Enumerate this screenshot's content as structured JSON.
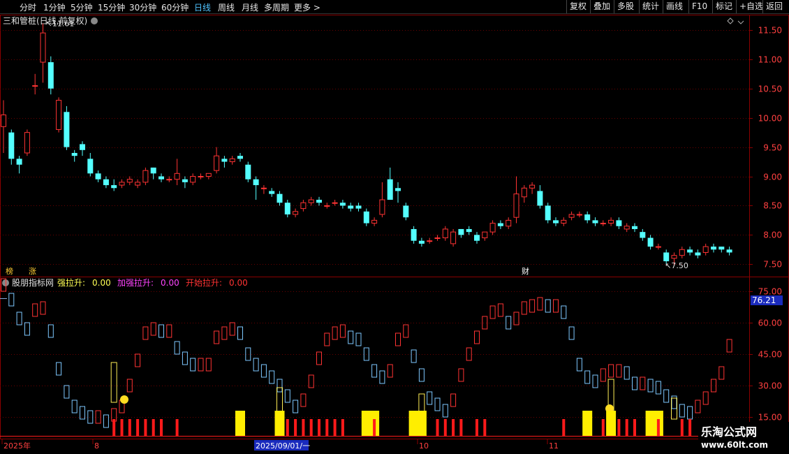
{
  "toolbar": {
    "periods": [
      "分时",
      "1分钟",
      "5分钟",
      "15分钟",
      "30分钟",
      "60分钟",
      "日线",
      "周线",
      "月线",
      "多周期",
      "更多 >"
    ],
    "active": "日线",
    "right": [
      "复权",
      "叠加",
      "多股",
      "统计",
      "画线",
      "F10",
      "标记",
      "+自选",
      "返回"
    ]
  },
  "main": {
    "title": "三和管桩(日线,前复权)",
    "y_ticks": [
      "11.50",
      "11.00",
      "10.50",
      "10.00",
      "9.50",
      "9.00",
      "8.50",
      "8.00",
      "7.50"
    ],
    "high_label": "11.61",
    "low_label": "7.50",
    "markers": [
      "榜",
      "涨",
      "财"
    ]
  },
  "indicator": {
    "name": "股朋指标网",
    "items": [
      {
        "label": "强拉升:",
        "value": "0.00",
        "color": "#ffff55"
      },
      {
        "label": "加强拉升:",
        "value": "0.00",
        "color": "#ff44ff"
      },
      {
        "label": "开始拉升:",
        "value": "0.00",
        "color": "#ff3333"
      }
    ],
    "current": "76.21",
    "y_ticks": [
      "75.00",
      "60.00",
      "45.00",
      "30.00",
      "15.00"
    ]
  },
  "dates": [
    "2025年",
    "8",
    "2025/09/01/一",
    "10",
    "11"
  ],
  "watermark": {
    "name": "乐淘公式网",
    "url": "www.60lt.com"
  },
  "colors": {
    "up": "#ff3333",
    "down": "#54ffff",
    "grid": "#8b0000",
    "hlines": "#6a0000"
  },
  "chart_data": {
    "type": "candlestick",
    "ylim": [
      7.3,
      11.75
    ],
    "candles": [
      [
        9.85,
        10.05,
        9.4,
        10.3
      ],
      [
        9.75,
        9.3,
        9.2,
        9.8
      ],
      [
        9.3,
        9.2,
        9.05,
        9.35
      ],
      [
        9.4,
        9.75,
        9.35,
        9.8
      ],
      [
        10.55,
        10.55,
        10.4,
        10.75
      ],
      [
        10.95,
        11.45,
        10.6,
        11.61
      ],
      [
        10.95,
        10.5,
        10.4,
        11.05
      ],
      [
        9.8,
        10.3,
        9.75,
        10.35
      ],
      [
        10.1,
        9.5,
        9.45,
        10.2
      ],
      [
        9.4,
        9.35,
        9.25,
        9.45
      ],
      [
        9.55,
        9.45,
        9.35,
        9.6
      ],
      [
        9.3,
        9.05,
        9.0,
        9.4
      ],
      [
        9.05,
        8.95,
        8.9,
        9.1
      ],
      [
        8.95,
        8.85,
        8.8,
        9.0
      ],
      [
        8.85,
        8.8,
        8.75,
        8.95
      ],
      [
        8.85,
        8.9,
        8.8,
        8.95
      ],
      [
        8.9,
        8.95,
        8.85,
        9.0
      ],
      [
        8.85,
        8.9,
        8.8,
        8.95
      ],
      [
        8.9,
        9.1,
        8.85,
        9.15
      ],
      [
        9.15,
        9.05,
        8.95,
        9.15
      ],
      [
        9.0,
        8.95,
        8.9,
        9.05
      ],
      [
        8.95,
        8.95,
        8.9,
        9.0
      ],
      [
        8.95,
        9.05,
        8.85,
        9.3
      ],
      [
        8.95,
        8.9,
        8.8,
        9.0
      ],
      [
        8.9,
        9.0,
        8.85,
        9.05
      ],
      [
        9.0,
        9.0,
        8.95,
        9.05
      ],
      [
        9.0,
        9.05,
        8.95,
        9.05
      ],
      [
        9.1,
        9.35,
        9.05,
        9.5
      ],
      [
        9.3,
        9.25,
        9.15,
        9.35
      ],
      [
        9.25,
        9.3,
        9.2,
        9.35
      ],
      [
        9.35,
        9.3,
        9.25,
        9.4
      ],
      [
        9.2,
        8.95,
        8.9,
        9.25
      ],
      [
        8.95,
        8.85,
        8.6,
        9.0
      ],
      [
        8.8,
        8.8,
        8.7,
        8.85
      ],
      [
        8.75,
        8.7,
        8.65,
        8.8
      ],
      [
        8.7,
        8.55,
        8.5,
        8.75
      ],
      [
        8.55,
        8.35,
        8.3,
        8.6
      ],
      [
        8.35,
        8.4,
        8.3,
        8.45
      ],
      [
        8.45,
        8.55,
        8.4,
        8.6
      ],
      [
        8.55,
        8.6,
        8.5,
        8.65
      ],
      [
        8.6,
        8.55,
        8.5,
        8.65
      ],
      [
        8.5,
        8.5,
        8.45,
        8.55
      ],
      [
        8.55,
        8.55,
        8.5,
        8.6
      ],
      [
        8.55,
        8.5,
        8.45,
        8.6
      ],
      [
        8.5,
        8.45,
        8.4,
        8.55
      ],
      [
        8.5,
        8.45,
        8.4,
        8.55
      ],
      [
        8.4,
        8.2,
        8.15,
        8.45
      ],
      [
        8.2,
        8.25,
        8.15,
        8.3
      ],
      [
        8.35,
        8.6,
        8.3,
        8.9
      ],
      [
        8.95,
        8.6,
        8.6,
        9.15
      ],
      [
        8.8,
        8.75,
        8.55,
        8.9
      ],
      [
        8.5,
        8.3,
        8.25,
        8.55
      ],
      [
        8.1,
        7.9,
        7.85,
        8.15
      ],
      [
        7.9,
        7.85,
        7.8,
        7.95
      ],
      [
        7.9,
        7.9,
        7.85,
        7.95
      ],
      [
        7.95,
        7.95,
        7.9,
        8.0
      ],
      [
        7.95,
        8.1,
        7.9,
        8.15
      ],
      [
        7.85,
        8.05,
        7.8,
        8.1
      ],
      [
        8.1,
        8.0,
        7.95,
        8.1
      ],
      [
        8.1,
        8.05,
        8.0,
        8.15
      ],
      [
        8.0,
        7.9,
        7.85,
        8.05
      ],
      [
        7.95,
        8.05,
        7.9,
        8.05
      ],
      [
        8.05,
        8.2,
        8.0,
        8.25
      ],
      [
        8.2,
        8.15,
        8.1,
        8.25
      ],
      [
        8.15,
        8.25,
        8.1,
        8.3
      ],
      [
        8.3,
        8.7,
        8.2,
        9.0
      ],
      [
        8.65,
        8.8,
        8.55,
        8.85
      ],
      [
        8.8,
        8.85,
        8.7,
        8.9
      ],
      [
        8.75,
        8.5,
        8.45,
        8.85
      ],
      [
        8.5,
        8.25,
        8.2,
        8.55
      ],
      [
        8.25,
        8.2,
        8.15,
        8.3
      ],
      [
        8.2,
        8.25,
        8.15,
        8.3
      ],
      [
        8.3,
        8.35,
        8.25,
        8.4
      ],
      [
        8.35,
        8.35,
        8.3,
        8.4
      ],
      [
        8.35,
        8.25,
        8.2,
        8.4
      ],
      [
        8.25,
        8.2,
        8.15,
        8.3
      ],
      [
        8.2,
        8.2,
        8.15,
        8.25
      ],
      [
        8.2,
        8.25,
        8.15,
        8.3
      ],
      [
        8.25,
        8.15,
        8.1,
        8.3
      ],
      [
        8.1,
        8.15,
        8.05,
        8.2
      ],
      [
        8.15,
        8.1,
        8.05,
        8.2
      ],
      [
        8.05,
        7.95,
        7.9,
        8.1
      ],
      [
        7.95,
        7.8,
        7.75,
        8.0
      ],
      [
        7.8,
        7.8,
        7.75,
        7.85
      ],
      [
        7.7,
        7.55,
        7.5,
        7.75
      ],
      [
        7.6,
        7.65,
        7.5,
        7.7
      ],
      [
        7.65,
        7.75,
        7.6,
        7.8
      ],
      [
        7.75,
        7.7,
        7.65,
        7.8
      ],
      [
        7.7,
        7.65,
        7.6,
        7.75
      ],
      [
        7.7,
        7.8,
        7.65,
        7.85
      ],
      [
        7.8,
        7.75,
        7.7,
        7.85
      ],
      [
        7.8,
        7.75,
        7.7,
        7.8
      ],
      [
        7.75,
        7.7,
        7.65,
        7.8
      ]
    ],
    "indicator_ylim": [
      5,
      80
    ],
    "indicator_values": [
      78,
      71,
      62,
      57,
      66,
      67,
      56,
      38,
      27,
      20,
      17,
      15,
      15,
      13,
      16,
      20,
      30,
      42,
      55,
      57,
      56,
      56,
      48,
      43,
      40,
      40,
      40,
      53,
      55,
      57,
      55,
      45,
      40,
      37,
      34,
      30,
      25,
      20,
      23,
      32,
      43,
      52,
      55,
      56,
      53,
      52,
      45,
      37,
      34,
      37,
      52,
      56,
      44,
      35,
      24,
      21,
      18,
      23,
      35,
      45,
      53,
      60,
      65,
      66,
      60,
      62,
      67,
      68,
      69,
      68,
      68,
      65,
      55,
      40,
      34,
      32,
      35,
      37,
      37,
      36,
      31,
      31,
      30,
      29,
      25,
      22,
      18,
      17,
      20,
      24,
      30,
      36,
      49,
      58,
      61,
      58,
      52
    ]
  }
}
